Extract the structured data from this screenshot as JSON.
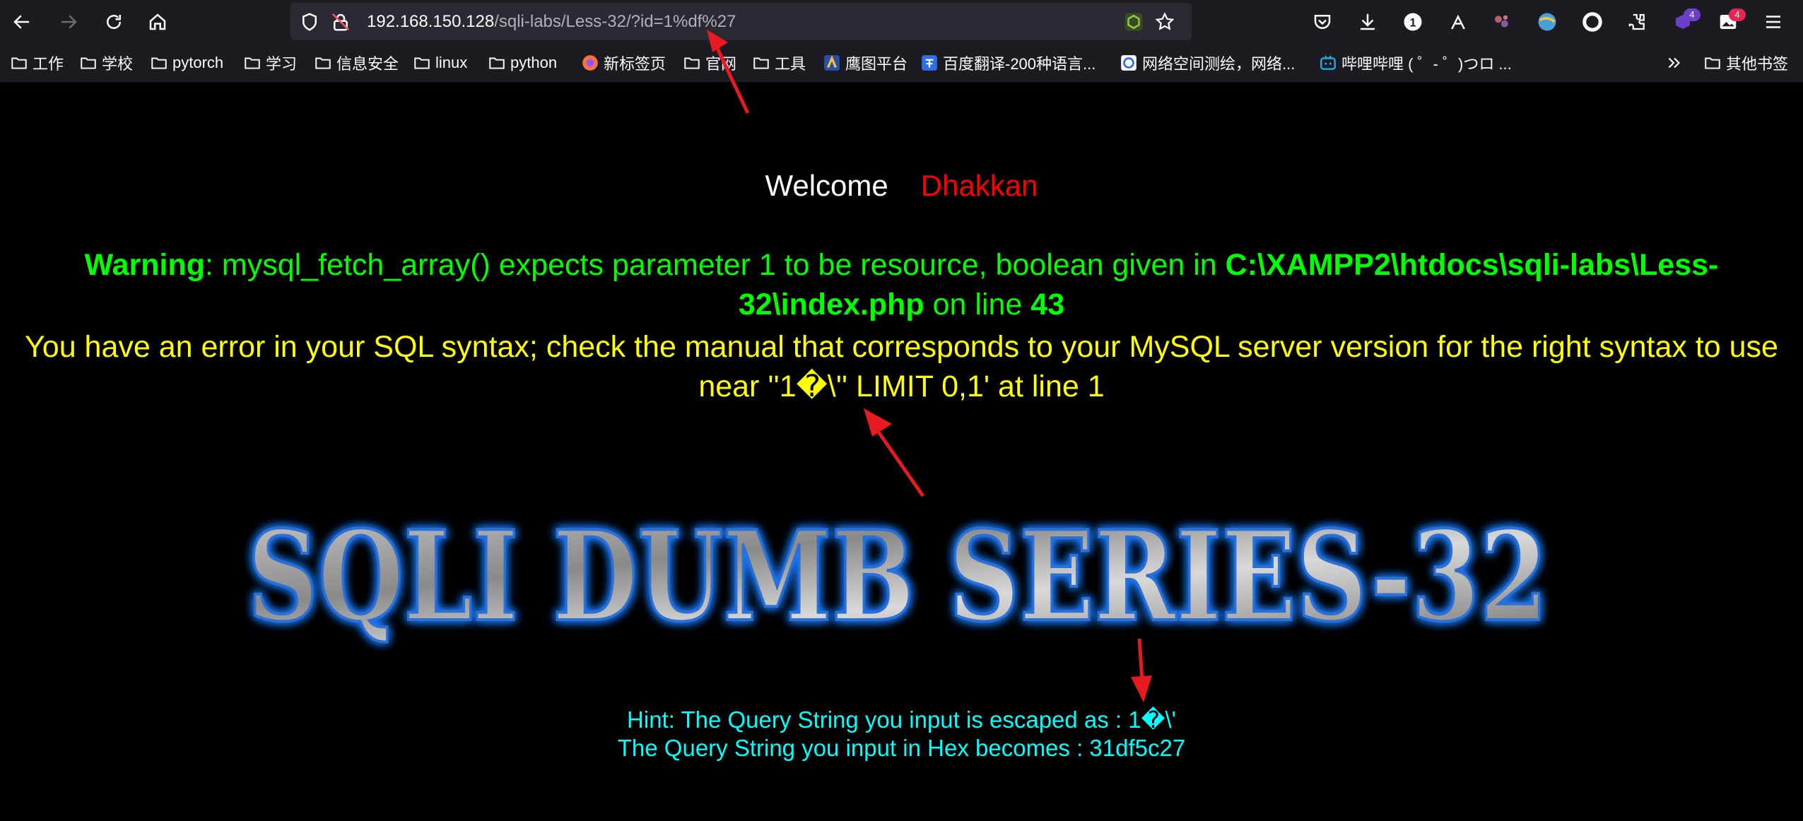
{
  "browser": {
    "url_host": "192.168.150.128",
    "url_path": "/sqli-labs/Less-32/?id=1%df%27",
    "badge_1": "1",
    "badge_purple": "4",
    "badge_red": "4"
  },
  "bookmarks": {
    "items": [
      "工作",
      "学校",
      "pytorch",
      "学习",
      "信息安全",
      "linux",
      "python",
      "新标签页",
      "官网",
      "工具",
      "鹰图平台",
      "百度翻译-200种语言...",
      "网络空间测绘，网络...",
      "哔哩哔哩 ( ゜- ゜)つロ ..."
    ],
    "overflow": "其他书签"
  },
  "page": {
    "welcome": "Welcome",
    "name": "Dhakkan",
    "warning_label": "Warning",
    "warning_text": ": mysql_fetch_array() expects parameter 1 to be resource, boolean given in ",
    "warning_file": "C:\\XAMPP2\\htdocs\\sqli-labs\\Less-32\\index.php",
    "warning_online": " on line ",
    "warning_line": "43",
    "sql_error": "You have an error in your SQL syntax; check the manual that corresponds to your MySQL server version for the right syntax to use near ''1�\\'' LIMIT 0,1' at line 1",
    "banner": "SQLI DUMB SERIES-32",
    "hint_escaped": "Hint: The Query String you input is escaped as : 1�\\'",
    "hint_hex": "The Query String you input in Hex becomes : 31df5c27"
  },
  "colors": {
    "page_bg": "#000000",
    "warning": "#00ff00",
    "error": "#ffff00",
    "hint": "#00ffff",
    "name": "#ff0000",
    "annotation_arrow": "#e8191f"
  },
  "icons": [
    "back-icon",
    "forward-icon",
    "reload-icon",
    "home-icon",
    "shield-icon",
    "insecure-lock-icon",
    "node-extension-icon",
    "bookmark-star-icon",
    "pocket-icon",
    "download-icon",
    "extensions-icon",
    "menu-icon",
    "folder-icon"
  ]
}
